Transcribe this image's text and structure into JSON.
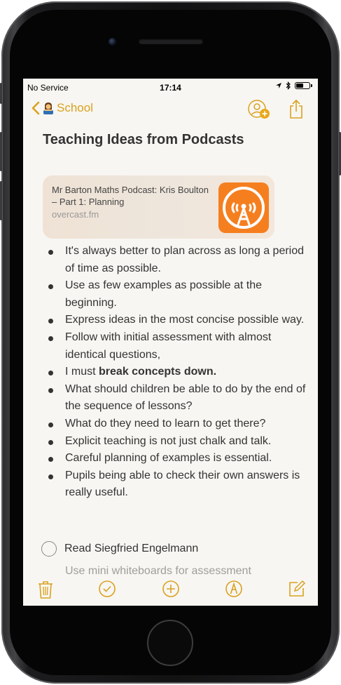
{
  "status_bar": {
    "carrier": "No Service",
    "time": "17:14",
    "battery_level": 0.55
  },
  "nav": {
    "back_label": "School",
    "back_icon": "chevron-left-icon",
    "folder_emoji_icon": "teacher-emoji-icon",
    "collaborate_icon": "add-person-icon",
    "share_icon": "share-icon"
  },
  "note": {
    "title": "Teaching Ideas from Podcasts",
    "link_card": {
      "title": "Mr Barton Maths Podcast: Kris Boulton – Part 1: Planning",
      "domain": "overcast.fm",
      "thumbnail_icon": "overcast-icon"
    },
    "bullets": [
      "It's always better to plan across as long a period of time as possible.",
      "Use as few examples as possible at the beginning.",
      "Express ideas in the most concise possible way.",
      "Follow with initial assessment with almost identical questions,",
      "I must ",
      "What should children be able to do by the end of the sequence of lessons?",
      "What do they need to learn to get there?",
      "Explicit teaching is not just chalk and talk.",
      "Careful planning of examples is essential.",
      "Pupils being able to check their own answers is really useful."
    ],
    "bold_phrase": "break concepts down.",
    "checklist": [
      {
        "label": "Read Siegfried Engelmann",
        "checked": false
      }
    ],
    "partial_item": "Use mini whiteboards for assessment"
  },
  "toolbar": {
    "icons": [
      "trash-icon",
      "checklist-icon",
      "add-icon",
      "markup-icon",
      "compose-icon"
    ]
  },
  "colors": {
    "accent": "#d9a21f",
    "paper": "#f8f6f2",
    "text": "#333333",
    "overcast_orange": "#f57f1f"
  }
}
